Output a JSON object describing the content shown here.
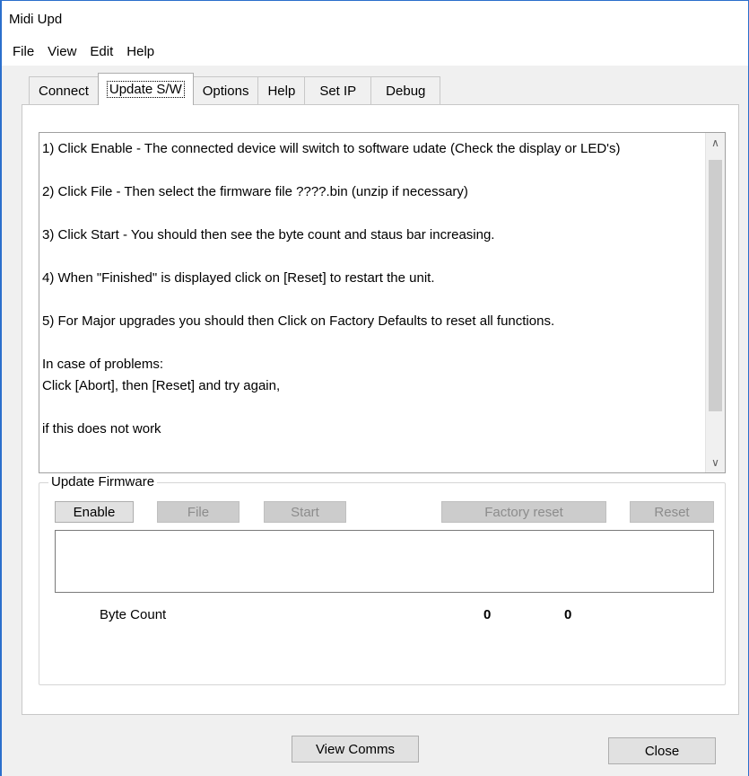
{
  "window": {
    "title": "Midi  Upd"
  },
  "menu": [
    "File",
    "View",
    "Edit",
    "Help"
  ],
  "tabs": [
    {
      "label": "Connect",
      "active": false
    },
    {
      "label": "Update S/W",
      "active": true
    },
    {
      "label": "Options",
      "active": false
    },
    {
      "label": "Help",
      "active": false
    },
    {
      "label": "Set IP",
      "active": false
    },
    {
      "label": "Debug",
      "active": false
    }
  ],
  "instructions": [
    "1) Click Enable - The connected device will switch to software udate (Check the display or LED's)",
    "",
    "2) Click File - Then select the firmware file ????.bin (unzip if necessary)",
    "",
    "3) Click Start - You should then see the byte count and staus bar increasing.",
    "",
    "4) When \"Finished\" is displayed click on [Reset] to restart the unit.",
    "",
    "5) For Major upgrades you should then Click on Factory Defaults to reset all functions.",
    "",
    "In case of problems:",
    "Click [Abort], then [Reset] and try again,",
    "",
    "if this does not work"
  ],
  "update_group": {
    "legend": "Update Firmware",
    "enable_label": "Enable",
    "file_label": "File",
    "start_label": "Start",
    "factory_reset_label": "Factory reset",
    "reset_label": "Reset",
    "byte_count_label": "Byte Count",
    "byte_count_value": "0",
    "total_value": "0"
  },
  "bottom": {
    "view_comms_label": "View Comms",
    "close_label": "Close"
  },
  "colors": {
    "window_border": "#2b6fcc",
    "disabled_button": "#cccccc"
  }
}
